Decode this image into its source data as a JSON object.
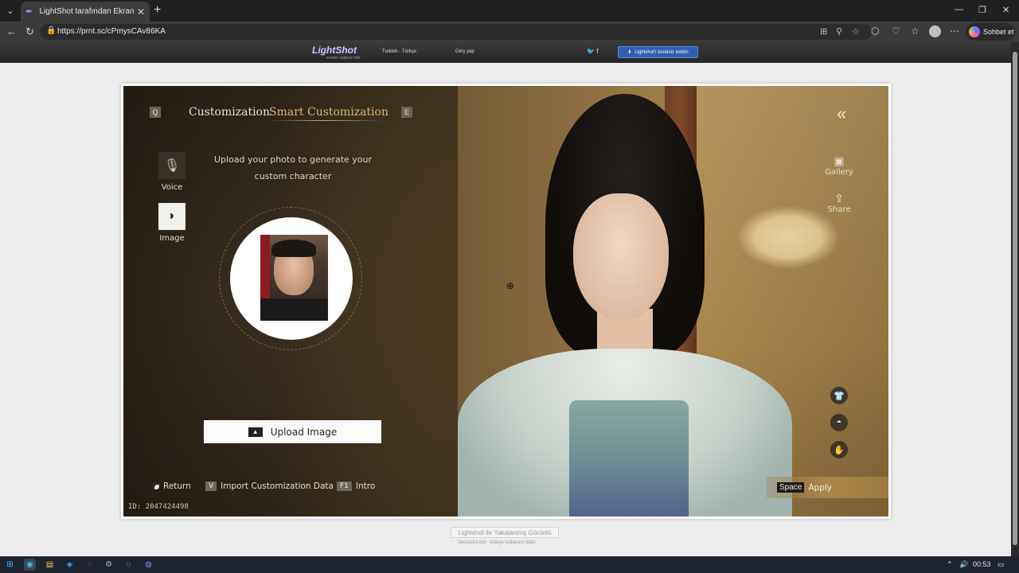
{
  "browser": {
    "tab_title": "LightShot tarafından Ekran Görüntüsü",
    "url": "https://prnt.sc/cPmysCAv86KA",
    "copilot_label": "Sohbet et"
  },
  "lightshot": {
    "logo": "LightShot",
    "logo_sub": "screen capture tool",
    "language": "Turkish - Türkçe",
    "login": "Giriş yap",
    "download": "Lightshot'ı ücretsiz indirin",
    "caption": "Lightshot ile Yakalanmış Görüntü",
    "link_similar": "benzerini bul",
    "link_report": "kötüye kullanımı bildir"
  },
  "game": {
    "key_q": "Q",
    "key_e": "E",
    "tab_customization": "Customization",
    "tab_smart": "Smart Customization",
    "side": {
      "voice": "Voice",
      "image": "Image"
    },
    "prompt": "Upload your photo to generate your custom character",
    "upload_button": "Upload Image",
    "bottom": {
      "return": "Return",
      "import_key": "V",
      "import": "Import Customization Data",
      "intro_key": "F1",
      "intro": "Intro"
    },
    "uid": "ID: 2047424498",
    "right": {
      "gallery": "Gallery",
      "share": "Share"
    },
    "apply_key": "Space",
    "apply": "Apply"
  },
  "taskbar": {
    "time": "00:53"
  },
  "icons": {
    "voice": "microphone-icon",
    "image": "face-mask-icon",
    "gallery": "picture-frame-icon",
    "share": "share-icon",
    "back": "double-chevron-left-icon"
  },
  "colors": {
    "active_tab": "#d8b877",
    "download_btn": "#2f5fb3",
    "apply_bar": "#a88748"
  }
}
